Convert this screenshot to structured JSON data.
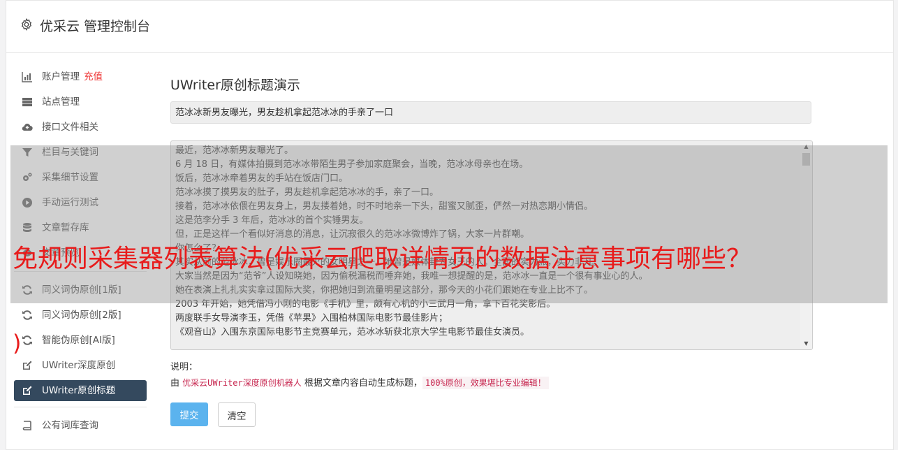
{
  "header": {
    "title": "优采云 管理控制台"
  },
  "sidebar": {
    "items": [
      {
        "label": "账户管理",
        "highlight": "充值",
        "icon": "bar-chart-icon"
      },
      {
        "label": "站点管理",
        "icon": "server-icon"
      },
      {
        "label": "接口文件相关",
        "icon": "cloud-upload-icon"
      },
      {
        "label": "栏目与关键词",
        "icon": "filter-icon"
      },
      {
        "label": "采集细节设置",
        "icon": "gears-icon"
      },
      {
        "label": "手动运行测试",
        "icon": "play-circle-icon"
      },
      {
        "label": "文章暂存库",
        "icon": "database-icon"
      },
      {
        "label": "文章预览",
        "icon": "eye-icon"
      }
    ],
    "tools": [
      {
        "label": "同义词伪原创[1版]",
        "icon": "refresh-icon"
      },
      {
        "label": "同义词伪原创[2版]",
        "icon": "refresh-icon"
      },
      {
        "label": "智能伪原创[AI版]",
        "icon": "refresh-icon"
      },
      {
        "label": "UWriter深度原创",
        "icon": "edit-icon"
      },
      {
        "label": "UWriter原创标题",
        "icon": "edit-icon",
        "active": true
      }
    ],
    "extra": [
      {
        "label": "公有词库查询",
        "icon": "book-icon"
      }
    ]
  },
  "main": {
    "heading": "UWriter原创标题演示",
    "title_value": "范冰冰新男友曝光，男友趁机拿起范冰冰的手亲了一口",
    "article_lines": [
      "最近，范冰冰新男友曝光了。",
      "6 月 18 日，有媒体拍摄到范冰冰带陌生男子参加家庭聚会，当晚，范冰冰母亲也在场。",
      "饭后，范冰冰牵着男友的手站在饭店门口。",
      "范冰冰摸了摸男友的肚子，男友趁机拿起范冰冰的手，亲了一口。",
      "接着，范冰冰依偎在男友身上，男友搂着她，时不时地亲一下头，甜蜜又腻歪，俨然一对热恋期小情侣。",
      "这是范李分手 3 年后，范冰冰的首个实锤男友。",
      "但，正是这样一个看似好消息的消息，让沉寂很久的范冰冰微博炸了锅，大家一片群嘲。",
      "你怎么了？",
      "其实从前的范冰冰，曾是娱乐圈最火的女明星之一。她曾是媒体封为女王的人。全面的实力派，实力非凡。",
      "大家当然是因为“范爷”人设知晓她，因为偷税漏税而唾弃她，我唯一想提醒的是，范冰冰一直是一个很有事业心的人。",
      "她在表演上扎扎实实拿过国际大奖，你把她归到流量明星这部分，那今天的小花们跟她在专业上比不了。",
      "2003 年开始，她凭借冯小刚的电影《手机》里，颇有心机的小三武月一角，拿下百花奖影后。",
      "两度联手女导演李玉，凭借《苹果》入围柏林国际电影节最佳影片；",
      "《观音山》入围东京国际电影节主竞赛单元，范冰冰斩获北京大学生电影节最佳女演员。"
    ],
    "note_label": "说明：",
    "note_prefix": "由",
    "note_link": "优采云UWriter深度原创机器人",
    "note_middle": "根据文章内容自动生成标题，",
    "note_badge": "100%原创，效果堪比专业编辑！",
    "submit_label": "提交",
    "clear_label": "清空"
  },
  "overlay": {
    "caption": "免规则采集器列表算法(优采云爬取详情页的数据注意事项有哪些？",
    "fragment": ")"
  }
}
